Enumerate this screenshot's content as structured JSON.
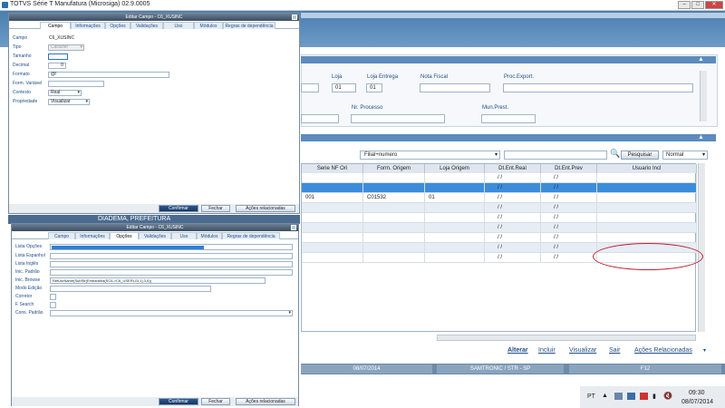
{
  "window": {
    "title": "TOTVS Série T Manufatura (Microsiga) 02.9.0005"
  },
  "header_fields": {
    "loja": "Loja",
    "loja_value": "01",
    "loja_entrega": "Loja Entrega",
    "loja_entrega_value": "01",
    "nota_fiscal": "Nota Fiscal",
    "proc_export": "Proc.Export.",
    "nr_processo": "Nr. Processo",
    "mun_prest": "Mun.Prest."
  },
  "search": {
    "select_value": "Filial+numero",
    "button": "Pesquisar",
    "mode": "Normal"
  },
  "grid": {
    "columns": [
      "Serie NF Ori",
      "Form. Origem",
      "Loja Origem",
      "Dt.Ent.Real",
      "Dt.Ent.Prev",
      "Usuario Incl"
    ],
    "rows": [
      [
        "",
        "",
        "",
        "/ /",
        "/ /",
        ""
      ],
      [
        "",
        "",
        "",
        "/ /",
        "/ /",
        ""
      ],
      [
        "001",
        "C01532",
        "01",
        "/ /",
        "/ /",
        ""
      ],
      [
        "",
        "",
        "",
        "/ /",
        "/ /",
        ""
      ],
      [
        "",
        "",
        "",
        "/ /",
        "/ /",
        ""
      ],
      [
        "",
        "",
        "",
        "/ /",
        "/ /",
        ""
      ],
      [
        "",
        "",
        "",
        "/ /",
        "/ /",
        ""
      ],
      [
        "",
        "",
        "",
        "/ /",
        "/ /",
        ""
      ],
      [
        "",
        "",
        "",
        "/ /",
        "/ /",
        ""
      ]
    ]
  },
  "actions": {
    "alterar": "Alterar",
    "incluir": "Incluir",
    "visualizar": "Visualizar",
    "sair": "Sair",
    "acoes": "Ações Relacionadas"
  },
  "status": {
    "date": "08/07/2014",
    "company": "SAMTRONIC / STR - SP",
    "key": "F12"
  },
  "dialog1": {
    "title": "Editar Campo - C6_XUSINC",
    "tabs": [
      "Campo",
      "Informações",
      "Opções",
      "Validações",
      "Uso",
      "Módulos",
      "Regras de dependência"
    ],
    "fields": [
      {
        "label": "Campo",
        "value": "C6_XUSINC"
      },
      {
        "label": "Tipo",
        "value": "Caracter"
      },
      {
        "label": "Tamanho",
        "value": ""
      },
      {
        "label": "Decimal",
        "value": "0"
      },
      {
        "label": "Formato",
        "value": "@!"
      },
      {
        "label": "Form. Variável",
        "value": ""
      },
      {
        "label": "Contexto",
        "value": "Real"
      },
      {
        "label": "Propriedade",
        "value": "Visualizar"
      }
    ],
    "buttons": {
      "confirm": "Confirmar",
      "close": "Fechar",
      "actions": "Ações relacionadas"
    }
  },
  "behind_text": "DIADEMA, PREFEITURA",
  "dialog2": {
    "title": "Editar Campo - C6_XUSINC",
    "tabs": [
      "Campo",
      "Informações",
      "Opções",
      "Validações",
      "Uso",
      "Módulos",
      "Regras de dependência"
    ],
    "fields": [
      {
        "label": "Lista Opções",
        "value": ""
      },
      {
        "label": "Lista Espanhol",
        "value": ""
      },
      {
        "label": "Lista Inglês",
        "value": ""
      },
      {
        "label": "Inic. Padrão",
        "value": ""
      },
      {
        "label": "Inic. Browse",
        "value": "RetUsrName(SubStr(Embaralha(SC6->C6_USERLGI,1),3,6))"
      },
      {
        "label": "Modo Edição",
        "value": ""
      },
      {
        "label": "Corretor",
        "value": ""
      },
      {
        "label": "F Search",
        "value": ""
      },
      {
        "label": "Cons. Padrão",
        "value": ""
      }
    ],
    "buttons": {
      "confirm": "Confirmar",
      "close": "Fechar",
      "actions": "Ações relacionadas"
    }
  },
  "tray": {
    "lang": "PT",
    "time": "09:30",
    "date": "08/07/2014"
  }
}
